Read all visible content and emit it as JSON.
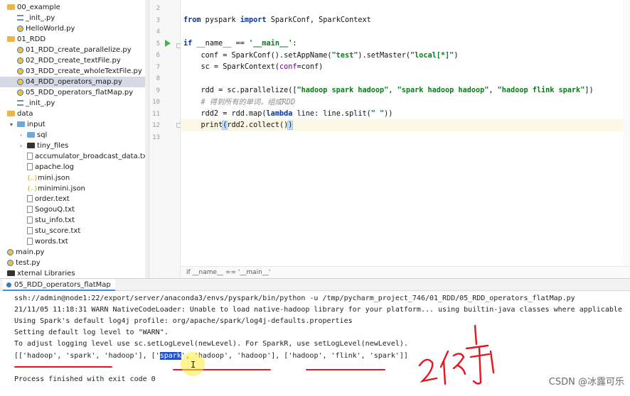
{
  "project_tree": {
    "items": [
      {
        "label": "00_example",
        "type": "folder"
      },
      {
        "label": "_init_.py",
        "type": "init"
      },
      {
        "label": "HelloWorld.py",
        "type": "py"
      },
      {
        "label": "01_RDD",
        "type": "folder"
      },
      {
        "label": "01_RDD_create_parallelize.py",
        "type": "py"
      },
      {
        "label": "02_RDD_create_textFile.py",
        "type": "py"
      },
      {
        "label": "03_RDD_create_wholeTextFile.py",
        "type": "py"
      },
      {
        "label": "04_RDD_operators_map.py",
        "type": "py",
        "selected": true
      },
      {
        "label": "05_RDD_operators_flatMap.py",
        "type": "py"
      },
      {
        "label": "_init_.py",
        "type": "init"
      },
      {
        "label": "data",
        "type": "folder-plain"
      },
      {
        "label": "input",
        "type": "folder-blue"
      },
      {
        "label": "sql",
        "type": "folder-blue"
      },
      {
        "label": "tiny_files",
        "type": "folder-black"
      },
      {
        "label": "accumulator_broadcast_data.txt",
        "type": "txt"
      },
      {
        "label": "apache.log",
        "type": "txt"
      },
      {
        "label": "mini.json",
        "type": "json"
      },
      {
        "label": "minimini.json",
        "type": "json"
      },
      {
        "label": "order.text",
        "type": "txt"
      },
      {
        "label": "SogouQ.txt",
        "type": "txt"
      },
      {
        "label": "stu_info.txt",
        "type": "txt"
      },
      {
        "label": "stu_score.txt",
        "type": "txt"
      },
      {
        "label": "words.txt",
        "type": "txt"
      },
      {
        "label": "main.py",
        "type": "py"
      },
      {
        "label": "test.py",
        "type": "py"
      },
      {
        "label": "xternal Libraries",
        "type": "lib"
      }
    ]
  },
  "editor": {
    "line_numbers": [
      "2",
      "3",
      "4",
      "5",
      "6",
      "7",
      "8",
      "9",
      "10",
      "11",
      "12",
      "13"
    ],
    "code": {
      "l3_a": "from",
      "l3_b": " pyspark ",
      "l3_c": "import",
      "l3_d": " SparkConf, SparkContext",
      "l5_a": "if",
      "l5_b": " __name__ == ",
      "l5_c": "'__main__'",
      "l5_d": ":",
      "l6_a": "    conf = SparkConf().setAppName(",
      "l6_b": "\"test\"",
      "l6_c": ").setMaster(",
      "l6_d": "\"local[*]\"",
      "l6_e": ")",
      "l7_a": "    sc = SparkContext(",
      "l7_b": "conf",
      "l7_c": "=conf)",
      "l9_a": "    rdd = sc.parallelize([",
      "l9_b": "\"hadoop spark hadoop\"",
      "l9_c": ", ",
      "l9_d": "\"spark hadoop hadoop\"",
      "l9_e": ", ",
      "l9_f": "\"hadoop flink spark\"",
      "l9_g": "])",
      "l10": "    # 得到所有的单词，组成RDD",
      "l11_a": "    rdd2 = rdd.map(",
      "l11_b": "lambda",
      "l11_c": " line: line.split(",
      "l11_d": "\" \"",
      "l11_e": "))",
      "l12_a": "    print",
      "l12_b": "(",
      "l12_c": "rdd2.collect()",
      "l12_d": ")"
    },
    "breadcrumb": "if __name__ == '__main__'"
  },
  "run_panel": {
    "tab_label": "05_RDD_operators_flatMap",
    "lines": {
      "cmd": "ssh://admin@node1:22/export/server/anaconda3/envs/pyspark/bin/python -u /tmp/pycharm_project_746/01_RDD/05_RDD_operators_flatMap.py",
      "warn": "21/11/05 11:18:31 WARN NativeCodeLoader: Unable to load native-hadoop library for your platform... using builtin-java classes where applicable",
      "profile": "Using Spark's default log4j profile: org/apache/spark/log4j-defaults.properties",
      "loglevel": "Setting default log level to \"WARN\".",
      "adjust": "To adjust logging level use sc.setLogLevel(newLevel). For SparkR, use setLogLevel(newLevel).",
      "result_a": "[['hadoop', 'spark', 'hadoop'], ['",
      "result_sel": "spark",
      "result_b": "', 'hadoop', 'hadoop'], ['hadoop', 'flink', 'spark']]",
      "finished": "Process finished with exit code 0"
    }
  },
  "annotation_handwriting": "2个列表",
  "watermark": "CSDN @冰露可乐",
  "colors": {
    "keyword": "#0033b3",
    "string": "#067d17",
    "selection": "#2153c7",
    "annotation": "#e8141e"
  }
}
